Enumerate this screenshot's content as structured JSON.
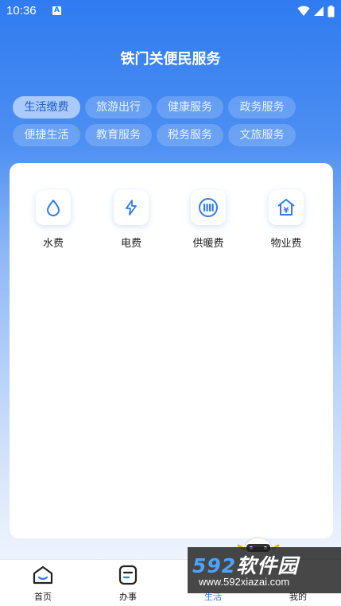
{
  "status_bar": {
    "time": "10:36",
    "notification_badge": "A"
  },
  "header": {
    "title": "铁门关便民服务"
  },
  "categories": [
    {
      "label": "生活缴费",
      "active": true
    },
    {
      "label": "旅游出行",
      "active": false
    },
    {
      "label": "健康服务",
      "active": false
    },
    {
      "label": "政务服务",
      "active": false
    },
    {
      "label": "便捷生活",
      "active": false
    },
    {
      "label": "教育服务",
      "active": false
    },
    {
      "label": "税务服务",
      "active": false
    },
    {
      "label": "文旅服务",
      "active": false
    }
  ],
  "services": [
    {
      "label": "水费",
      "icon": "water-drop-icon"
    },
    {
      "label": "电费",
      "icon": "lightning-icon"
    },
    {
      "label": "供暖费",
      "icon": "radiator-icon"
    },
    {
      "label": "物业费",
      "icon": "house-yuan-icon"
    }
  ],
  "tabbar": {
    "tabs": [
      {
        "label": "首页",
        "icon": "home-icon",
        "active": false
      },
      {
        "label": "办事",
        "icon": "document-icon",
        "active": false
      },
      {
        "label": "生活",
        "icon": "life-icon",
        "active": true
      },
      {
        "label": "我的",
        "icon": "profile-icon",
        "active": false
      }
    ]
  },
  "watermark": {
    "number": "592",
    "brand": "软件园",
    "url": "www.592xiazai.com"
  },
  "colors": {
    "primary": "#2f7bf0",
    "card_bg": "#ffffff",
    "text": "#222222"
  }
}
